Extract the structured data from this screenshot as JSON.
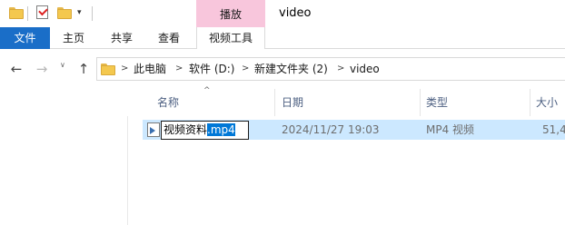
{
  "title_bar": {
    "window_title": "video",
    "context_tab_group": "播放",
    "accent_colors": {
      "file_tab": "#1a6ec8",
      "context_tab": "#f8c6dc",
      "selection": "#cce8ff"
    }
  },
  "ribbon": {
    "tabs": [
      {
        "label": "文件"
      },
      {
        "label": "主页"
      },
      {
        "label": "共享"
      },
      {
        "label": "查看"
      },
      {
        "label": "视频工具"
      }
    ]
  },
  "navigation": {
    "back_icon": "←",
    "forward_icon": "→",
    "recent_dropdown_icon": "∨",
    "up_icon": "↑",
    "breadcrumb": [
      "此电脑",
      "软件 (D:)",
      "新建文件夹 (2)",
      "video"
    ],
    "separator": ">"
  },
  "columns": {
    "name": "名称",
    "date": "日期",
    "type": "类型",
    "size": "大小"
  },
  "files": [
    {
      "name_base": "视频资料",
      "name_ext": ".mp4",
      "date": "2024/11/27 19:03",
      "type": "MP4 视频",
      "size": "51,4"
    }
  ]
}
